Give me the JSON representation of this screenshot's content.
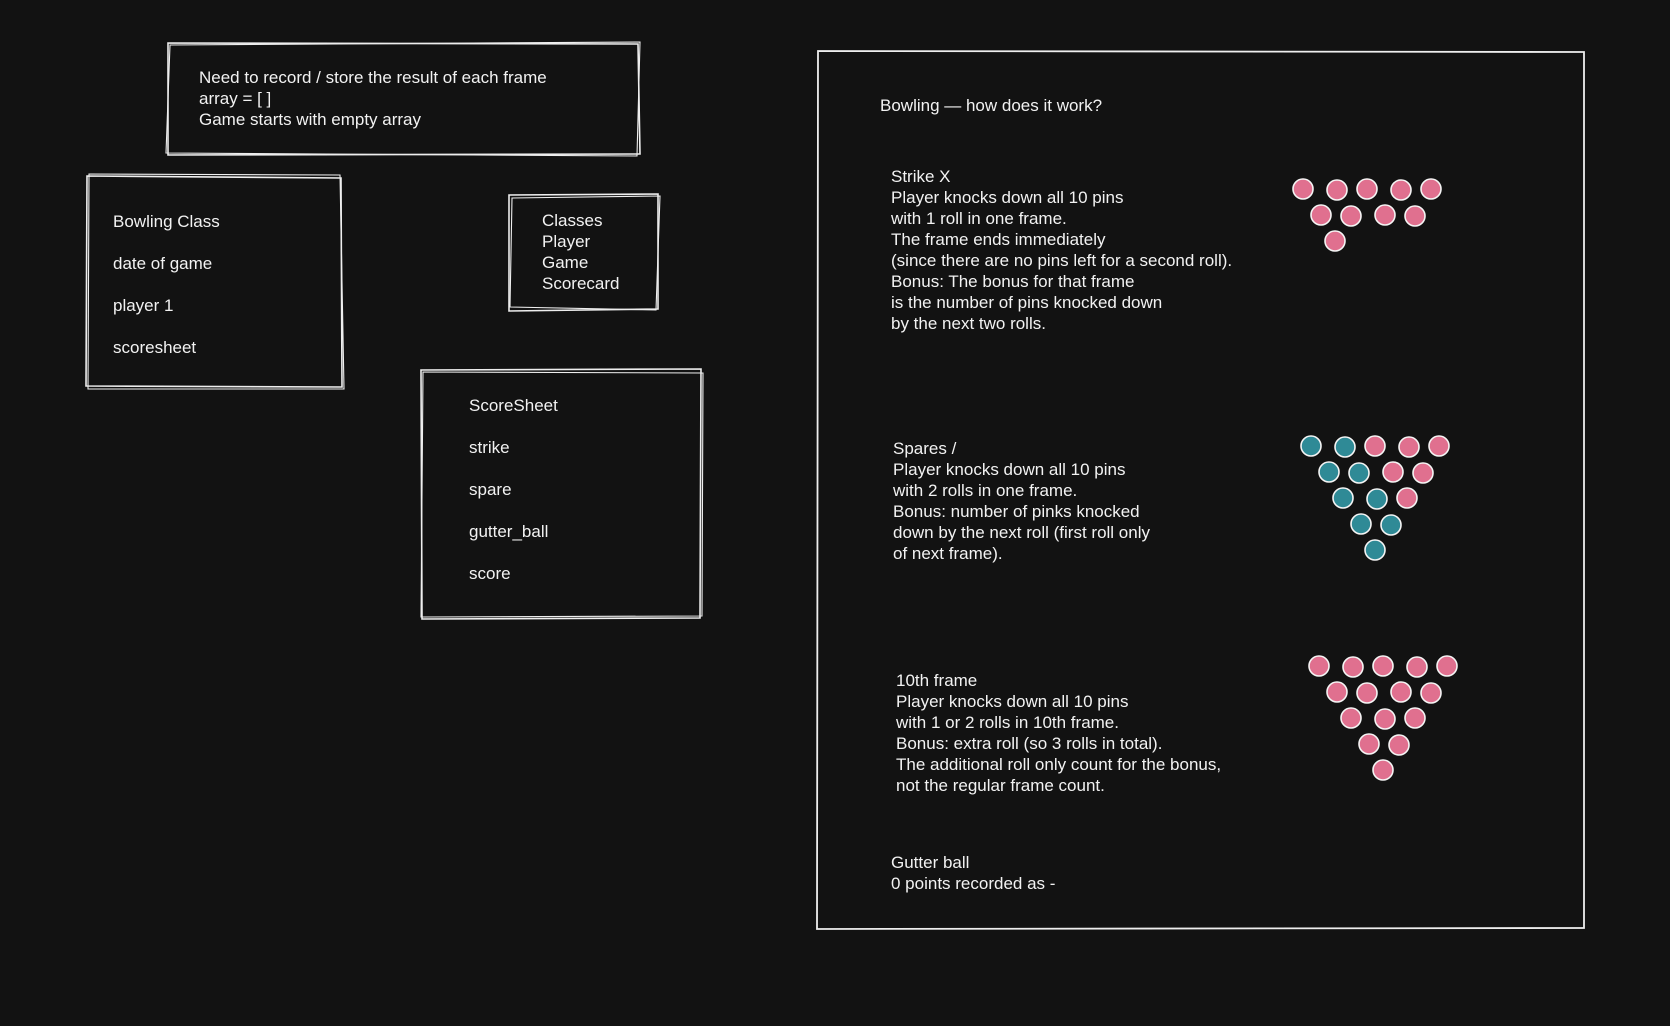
{
  "notes": {
    "frame_result": [
      "Need to record / store the result of each frame",
      "array = [  ]",
      "Game starts with empty array"
    ],
    "bowling_class": [
      "Bowling Class",
      "date of game",
      "player 1",
      "scoresheet"
    ],
    "classes": [
      "Classes",
      "Player",
      "Game",
      "Scorecard"
    ],
    "scoresheet": [
      "ScoreSheet",
      "strike",
      "spare",
      "gutter_ball",
      "score"
    ]
  },
  "rules": {
    "title": "Bowling — how does it work?",
    "strike": {
      "lines": [
        "Strike X",
        "Player knocks down all 10 pins",
        "with 1 roll in one frame.",
        "The frame ends immediately",
        "(since there are no pins left for a second roll).",
        "Bonus: The bonus for that frame",
        "is the number of pins knocked down",
        "by the next two rolls."
      ],
      "pins": [
        "pink",
        "pink",
        "pink",
        "pink",
        "pink",
        "pink",
        "pink",
        "pink",
        "pink",
        "pink"
      ]
    },
    "spares": {
      "lines": [
        "Spares /",
        "Player knocks down all 10 pins",
        "with 2 rolls in one frame.",
        "Bonus: number of pinks knocked",
        "down by the next roll (first roll only",
        "of next frame)."
      ],
      "pins": [
        "teal",
        "teal",
        "pink",
        "pink",
        "pink",
        "teal",
        "teal",
        "pink",
        "pink",
        "teal",
        "teal",
        "pink",
        "teal",
        "teal",
        "teal"
      ]
    },
    "tenth": {
      "lines": [
        "10th frame",
        "Player knocks down all 10 pins",
        "with 1 or 2 rolls in 10th frame.",
        "Bonus: extra roll (so 3 rolls in total).",
        "The additional roll only count for the bonus,",
        "not the regular frame count."
      ],
      "pins": [
        "pink",
        "pink",
        "pink",
        "pink",
        "pink",
        "pink",
        "pink",
        "pink",
        "pink",
        "pink",
        "pink",
        "pink",
        "pink",
        "pink",
        "pink"
      ]
    },
    "gutter": {
      "lines": [
        "Gutter ball",
        "0 points recorded as -"
      ]
    }
  },
  "colors": {
    "pink": "#e0708f",
    "teal": "#2f8a96",
    "stroke": "#eeeeee",
    "background": "#121212"
  }
}
